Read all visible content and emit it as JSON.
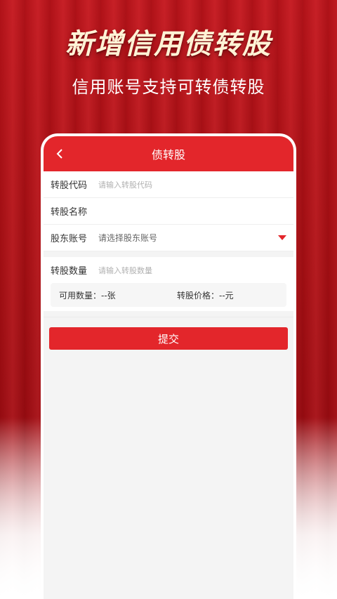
{
  "promo": {
    "headline": "新增信用债转股",
    "subheadline": "信用账号支持可转债转股"
  },
  "navbar": {
    "title": "债转股",
    "back_icon": "chevron-left-icon"
  },
  "form": {
    "code": {
      "label": "转股代码",
      "placeholder": "请输入转股代码"
    },
    "name": {
      "label": "转股名称",
      "value": ""
    },
    "account": {
      "label": "股东账号",
      "placeholder": "请选择股东账号",
      "dropdown_icon": "caret-down-icon"
    },
    "quantity": {
      "label": "转股数量",
      "placeholder": "请输入转股数量"
    },
    "available": {
      "label": "可用数量：",
      "value": "--张"
    },
    "price": {
      "label": "转股价格：",
      "value": "--元"
    }
  },
  "submit_label": "提交",
  "colors": {
    "accent": "#e3262b",
    "background": "#b30e14",
    "headline": "#fff3d6"
  }
}
